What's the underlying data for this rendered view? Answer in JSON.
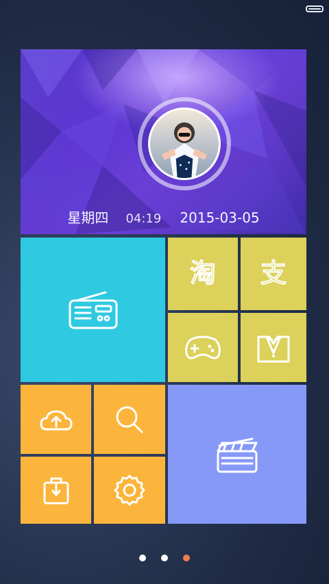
{
  "status": {
    "battery_icon": "battery-full-icon"
  },
  "header": {
    "weekday": "星期四",
    "time": "04:19",
    "date": "2015-03-05",
    "avatar_icon": "user-avatar"
  },
  "tiles": [
    {
      "id": "radio",
      "icon": "radio-icon",
      "color": "#30c9e2"
    },
    {
      "id": "taobao",
      "icon": "taobao-icon",
      "text": "淘",
      "color": "#dbd15b"
    },
    {
      "id": "alipay",
      "icon": "alipay-icon",
      "text": "支",
      "color": "#dbd15b"
    },
    {
      "id": "game",
      "icon": "gamepad-icon",
      "color": "#dbd15b"
    },
    {
      "id": "suit",
      "icon": "suit-bowtie-icon",
      "color": "#dbd15b"
    },
    {
      "id": "cloud",
      "icon": "cloud-upload-icon",
      "color": "#fbb53c"
    },
    {
      "id": "search",
      "icon": "search-icon",
      "color": "#fbb53c"
    },
    {
      "id": "bag",
      "icon": "bag-icon",
      "color": "#fbb53c"
    },
    {
      "id": "settings",
      "icon": "gear-icon",
      "color": "#fbb53c"
    },
    {
      "id": "video",
      "icon": "clapperboard-icon",
      "color": "#8799f7"
    }
  ],
  "pager": {
    "count": 3,
    "active_index": 2
  }
}
